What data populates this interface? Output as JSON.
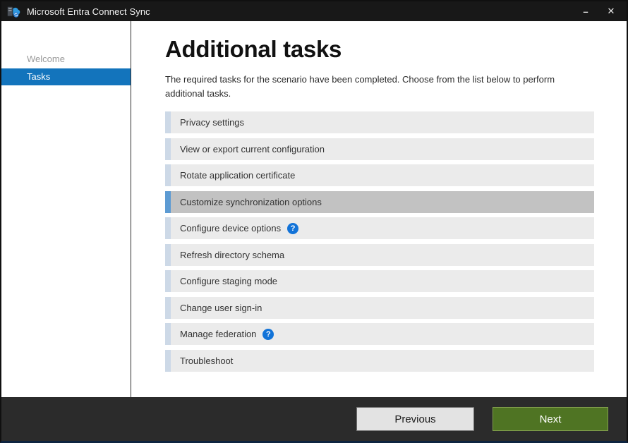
{
  "window": {
    "title": "Microsoft Entra Connect Sync",
    "controls": {
      "minimize_glyph": "–",
      "close_glyph": "✕"
    }
  },
  "sidebar": {
    "items": [
      {
        "label": "Welcome",
        "active": false
      },
      {
        "label": "Tasks",
        "active": true
      }
    ]
  },
  "main": {
    "heading": "Additional tasks",
    "description": "The required tasks for the scenario have been completed. Choose from the list below to perform additional tasks.",
    "help_glyph": "?",
    "tasks": [
      {
        "label": "Privacy settings",
        "selected": false,
        "help": false
      },
      {
        "label": "View or export current configuration",
        "selected": false,
        "help": false
      },
      {
        "label": "Rotate application certificate",
        "selected": false,
        "help": false
      },
      {
        "label": "Customize synchronization options",
        "selected": true,
        "help": false
      },
      {
        "label": "Configure device options",
        "selected": false,
        "help": true
      },
      {
        "label": "Refresh directory schema",
        "selected": false,
        "help": false
      },
      {
        "label": "Configure staging mode",
        "selected": false,
        "help": false
      },
      {
        "label": "Change user sign-in",
        "selected": false,
        "help": false
      },
      {
        "label": "Manage federation",
        "selected": false,
        "help": true
      },
      {
        "label": "Troubleshoot",
        "selected": false,
        "help": false
      }
    ]
  },
  "footer": {
    "previous_label": "Previous",
    "next_label": "Next"
  },
  "colors": {
    "titlebar_bg": "#181818",
    "sidebar_active_blue": "#1374bc",
    "row_bg": "#ebebeb",
    "row_accent": "#cdd9e7",
    "selected_row_bg": "#c2c2c2",
    "selected_row_accent": "#5d9bd3",
    "help_icon_blue": "#1273d8",
    "next_button_green": "#4f7423",
    "footer_bg": "#2b2b2b"
  }
}
